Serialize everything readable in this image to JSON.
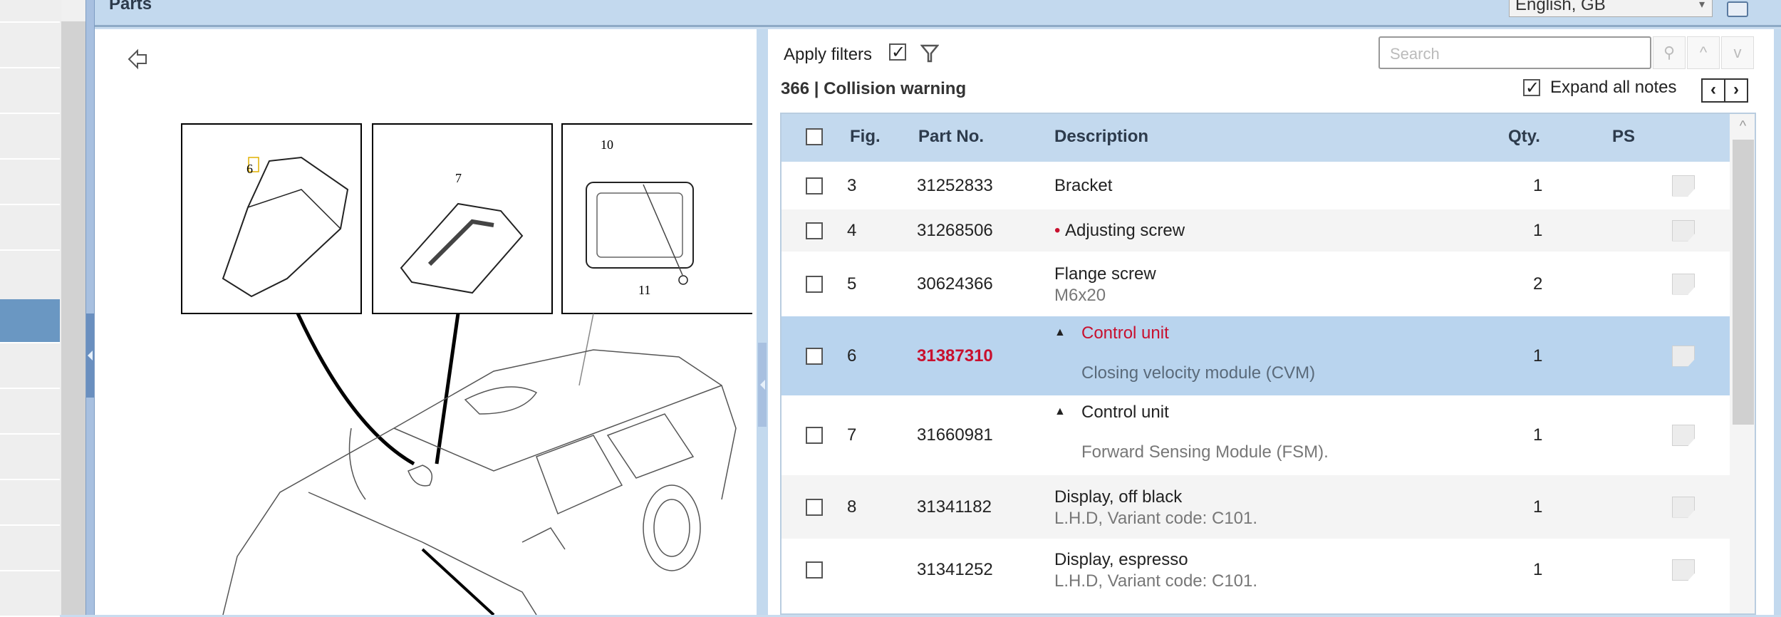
{
  "header": {
    "title": "Parts",
    "language": "English, GB"
  },
  "diagram": {
    "callouts": [
      "6",
      "7",
      "10",
      "11"
    ]
  },
  "toolbar": {
    "apply_filters": "Apply filters",
    "apply_filters_checked": true,
    "search_placeholder": "Search",
    "expand_all_notes": "Expand all notes",
    "expand_checked": true,
    "prev": "‹",
    "next": "›"
  },
  "group": {
    "number": "366",
    "separator": "|",
    "name": "Collision warning"
  },
  "table": {
    "headers": {
      "fig": "Fig.",
      "part_no": "Part No.",
      "description": "Description",
      "qty": "Qty.",
      "ps": "PS"
    },
    "rows": [
      {
        "fig": "3",
        "part_no": "31252833",
        "description": "Bracket",
        "note": "",
        "qty": "1"
      },
      {
        "fig": "4",
        "part_no": "31268506",
        "description": "Adjusting screw",
        "note": "",
        "qty": "1",
        "bullet": "•"
      },
      {
        "fig": "5",
        "part_no": "30624366",
        "description": "Flange screw",
        "note": "M6x20",
        "qty": "2"
      },
      {
        "fig": "6",
        "part_no": "31387310",
        "description": "Control unit",
        "note": "Closing velocity module (CVM)",
        "qty": "1",
        "selected": true,
        "expander": "▲"
      },
      {
        "fig": "7",
        "part_no": "31660981",
        "description": "Control unit",
        "note": "Forward Sensing Module (FSM).",
        "qty": "1",
        "expander": "▲"
      },
      {
        "fig": "8",
        "part_no": "31341182",
        "description": "Display, off black",
        "note": "L.H.D, Variant code: C101.",
        "qty": "1"
      },
      {
        "fig": "",
        "part_no": "31341252",
        "description": "Display, espresso",
        "note": "L.H.D, Variant code: C101.",
        "qty": "1"
      }
    ]
  },
  "colors": {
    "accent": "#c3d9ee",
    "selected_row": "#b9d4ee",
    "highlight_red": "#c8102e"
  }
}
